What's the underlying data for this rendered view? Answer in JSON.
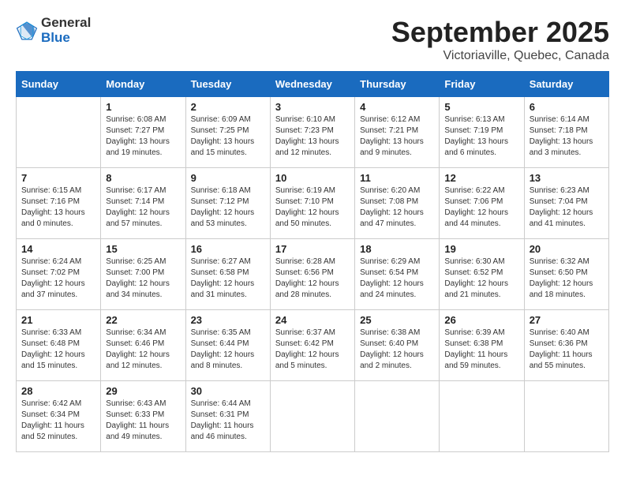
{
  "logo": {
    "general": "General",
    "blue": "Blue"
  },
  "title": "September 2025",
  "location": "Victoriaville, Quebec, Canada",
  "weekdays": [
    "Sunday",
    "Monday",
    "Tuesday",
    "Wednesday",
    "Thursday",
    "Friday",
    "Saturday"
  ],
  "weeks": [
    [
      {
        "day": "",
        "sunrise": "",
        "sunset": "",
        "daylight": ""
      },
      {
        "day": "1",
        "sunrise": "Sunrise: 6:08 AM",
        "sunset": "Sunset: 7:27 PM",
        "daylight": "Daylight: 13 hours and 19 minutes."
      },
      {
        "day": "2",
        "sunrise": "Sunrise: 6:09 AM",
        "sunset": "Sunset: 7:25 PM",
        "daylight": "Daylight: 13 hours and 15 minutes."
      },
      {
        "day": "3",
        "sunrise": "Sunrise: 6:10 AM",
        "sunset": "Sunset: 7:23 PM",
        "daylight": "Daylight: 13 hours and 12 minutes."
      },
      {
        "day": "4",
        "sunrise": "Sunrise: 6:12 AM",
        "sunset": "Sunset: 7:21 PM",
        "daylight": "Daylight: 13 hours and 9 minutes."
      },
      {
        "day": "5",
        "sunrise": "Sunrise: 6:13 AM",
        "sunset": "Sunset: 7:19 PM",
        "daylight": "Daylight: 13 hours and 6 minutes."
      },
      {
        "day": "6",
        "sunrise": "Sunrise: 6:14 AM",
        "sunset": "Sunset: 7:18 PM",
        "daylight": "Daylight: 13 hours and 3 minutes."
      }
    ],
    [
      {
        "day": "7",
        "sunrise": "Sunrise: 6:15 AM",
        "sunset": "Sunset: 7:16 PM",
        "daylight": "Daylight: 13 hours and 0 minutes."
      },
      {
        "day": "8",
        "sunrise": "Sunrise: 6:17 AM",
        "sunset": "Sunset: 7:14 PM",
        "daylight": "Daylight: 12 hours and 57 minutes."
      },
      {
        "day": "9",
        "sunrise": "Sunrise: 6:18 AM",
        "sunset": "Sunset: 7:12 PM",
        "daylight": "Daylight: 12 hours and 53 minutes."
      },
      {
        "day": "10",
        "sunrise": "Sunrise: 6:19 AM",
        "sunset": "Sunset: 7:10 PM",
        "daylight": "Daylight: 12 hours and 50 minutes."
      },
      {
        "day": "11",
        "sunrise": "Sunrise: 6:20 AM",
        "sunset": "Sunset: 7:08 PM",
        "daylight": "Daylight: 12 hours and 47 minutes."
      },
      {
        "day": "12",
        "sunrise": "Sunrise: 6:22 AM",
        "sunset": "Sunset: 7:06 PM",
        "daylight": "Daylight: 12 hours and 44 minutes."
      },
      {
        "day": "13",
        "sunrise": "Sunrise: 6:23 AM",
        "sunset": "Sunset: 7:04 PM",
        "daylight": "Daylight: 12 hours and 41 minutes."
      }
    ],
    [
      {
        "day": "14",
        "sunrise": "Sunrise: 6:24 AM",
        "sunset": "Sunset: 7:02 PM",
        "daylight": "Daylight: 12 hours and 37 minutes."
      },
      {
        "day": "15",
        "sunrise": "Sunrise: 6:25 AM",
        "sunset": "Sunset: 7:00 PM",
        "daylight": "Daylight: 12 hours and 34 minutes."
      },
      {
        "day": "16",
        "sunrise": "Sunrise: 6:27 AM",
        "sunset": "Sunset: 6:58 PM",
        "daylight": "Daylight: 12 hours and 31 minutes."
      },
      {
        "day": "17",
        "sunrise": "Sunrise: 6:28 AM",
        "sunset": "Sunset: 6:56 PM",
        "daylight": "Daylight: 12 hours and 28 minutes."
      },
      {
        "day": "18",
        "sunrise": "Sunrise: 6:29 AM",
        "sunset": "Sunset: 6:54 PM",
        "daylight": "Daylight: 12 hours and 24 minutes."
      },
      {
        "day": "19",
        "sunrise": "Sunrise: 6:30 AM",
        "sunset": "Sunset: 6:52 PM",
        "daylight": "Daylight: 12 hours and 21 minutes."
      },
      {
        "day": "20",
        "sunrise": "Sunrise: 6:32 AM",
        "sunset": "Sunset: 6:50 PM",
        "daylight": "Daylight: 12 hours and 18 minutes."
      }
    ],
    [
      {
        "day": "21",
        "sunrise": "Sunrise: 6:33 AM",
        "sunset": "Sunset: 6:48 PM",
        "daylight": "Daylight: 12 hours and 15 minutes."
      },
      {
        "day": "22",
        "sunrise": "Sunrise: 6:34 AM",
        "sunset": "Sunset: 6:46 PM",
        "daylight": "Daylight: 12 hours and 12 minutes."
      },
      {
        "day": "23",
        "sunrise": "Sunrise: 6:35 AM",
        "sunset": "Sunset: 6:44 PM",
        "daylight": "Daylight: 12 hours and 8 minutes."
      },
      {
        "day": "24",
        "sunrise": "Sunrise: 6:37 AM",
        "sunset": "Sunset: 6:42 PM",
        "daylight": "Daylight: 12 hours and 5 minutes."
      },
      {
        "day": "25",
        "sunrise": "Sunrise: 6:38 AM",
        "sunset": "Sunset: 6:40 PM",
        "daylight": "Daylight: 12 hours and 2 minutes."
      },
      {
        "day": "26",
        "sunrise": "Sunrise: 6:39 AM",
        "sunset": "Sunset: 6:38 PM",
        "daylight": "Daylight: 11 hours and 59 minutes."
      },
      {
        "day": "27",
        "sunrise": "Sunrise: 6:40 AM",
        "sunset": "Sunset: 6:36 PM",
        "daylight": "Daylight: 11 hours and 55 minutes."
      }
    ],
    [
      {
        "day": "28",
        "sunrise": "Sunrise: 6:42 AM",
        "sunset": "Sunset: 6:34 PM",
        "daylight": "Daylight: 11 hours and 52 minutes."
      },
      {
        "day": "29",
        "sunrise": "Sunrise: 6:43 AM",
        "sunset": "Sunset: 6:33 PM",
        "daylight": "Daylight: 11 hours and 49 minutes."
      },
      {
        "day": "30",
        "sunrise": "Sunrise: 6:44 AM",
        "sunset": "Sunset: 6:31 PM",
        "daylight": "Daylight: 11 hours and 46 minutes."
      },
      {
        "day": "",
        "sunrise": "",
        "sunset": "",
        "daylight": ""
      },
      {
        "day": "",
        "sunrise": "",
        "sunset": "",
        "daylight": ""
      },
      {
        "day": "",
        "sunrise": "",
        "sunset": "",
        "daylight": ""
      },
      {
        "day": "",
        "sunrise": "",
        "sunset": "",
        "daylight": ""
      }
    ]
  ]
}
